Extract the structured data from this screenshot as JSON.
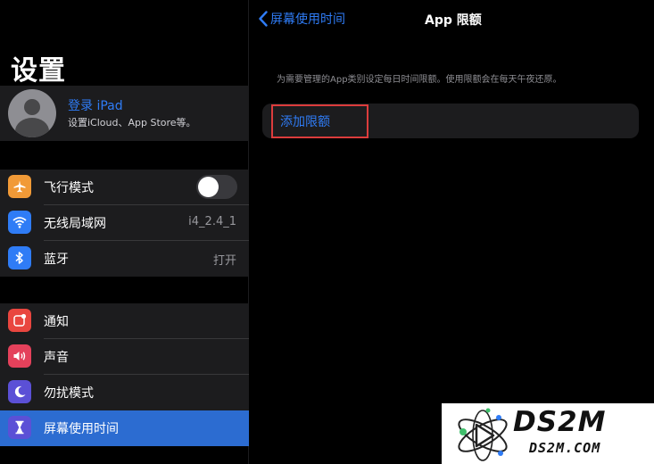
{
  "sidebar": {
    "title": "设置",
    "account": {
      "title": "登录 iPad",
      "subtitle": "设置iCloud、App Store等。"
    },
    "group1": [
      {
        "label": "飞行模式",
        "icon": "airplane-icon",
        "color": "#f19a37",
        "toggle": false
      },
      {
        "label": "无线局域网",
        "icon": "wifi-icon",
        "color": "#2f7cf6",
        "value": "i4_2.4_1"
      },
      {
        "label": "蓝牙",
        "icon": "bluetooth-icon",
        "color": "#2f7cf6",
        "value": "打开"
      }
    ],
    "group2": [
      {
        "label": "通知",
        "icon": "notifications-icon",
        "color": "#e9463f"
      },
      {
        "label": "声音",
        "icon": "sound-icon",
        "color": "#e4415b"
      },
      {
        "label": "勿扰模式",
        "icon": "moon-icon",
        "color": "#5b50d6"
      },
      {
        "label": "屏幕使用时间",
        "icon": "hourglass-icon",
        "color": "#5b50d6",
        "selected": true
      }
    ]
  },
  "nav": {
    "back_label": "屏幕使用时间",
    "title": "App 限额"
  },
  "main": {
    "description": "为需要管理的App类别设定每日时间限额。使用限额会在每天午夜还原。",
    "add_limit_label": "添加限额"
  },
  "watermark": {
    "main": "DS2M",
    "sub": "DS2M.COM"
  },
  "colors": {
    "accent": "#2f7cf6",
    "selected": "#2c6cd1",
    "highlight_box": "#dc3c3c"
  }
}
